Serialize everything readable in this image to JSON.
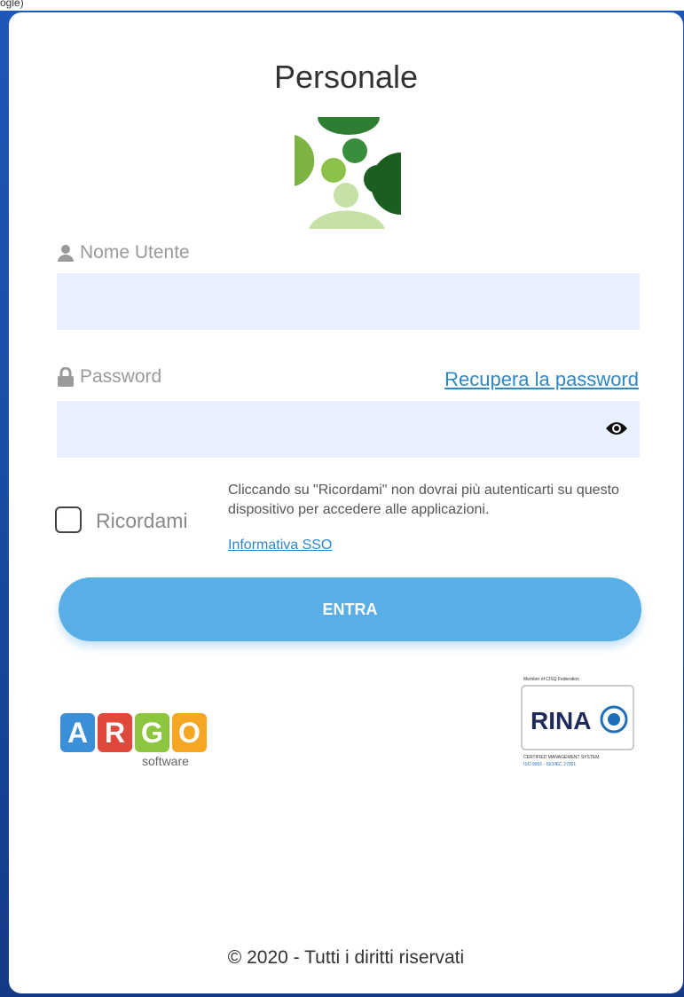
{
  "page": {
    "top_text": "ogle)",
    "title": "Personale",
    "copyright": "© 2020 - Tutti i diritti riservati"
  },
  "login": {
    "username_label": "Nome Utente",
    "username_value": "",
    "password_label": "Password",
    "password_value": "",
    "recover_link": "Recupera la password",
    "remember_label": "Ricordami",
    "remember_checked": false,
    "remember_note": "Cliccando su \"Ricordami\" non dovrai più autenticarti su questo dispositivo per accedere alle applicazioni.",
    "sso_link": "Informativa SSO",
    "submit_label": "ENTRA"
  },
  "icons": {
    "user": "user-icon",
    "lock": "lock-icon",
    "eye": "eye-icon"
  },
  "branding": {
    "argo_letters": [
      "A",
      "R",
      "G",
      "O"
    ],
    "argo_colors": [
      "#3a8fd8",
      "#e0483c",
      "#8cc63f",
      "#f5a623"
    ],
    "argo_sub": "software",
    "rina_text": "RINA",
    "rina_top": "Member of CISQ Federation",
    "rina_bottom1": "CERTIFIED MANAGEMENT SYSTEM",
    "rina_bottom2": "ISO 9001 - ISO/IEC 27001"
  },
  "colors": {
    "field_bg": "#e8f0fe",
    "button_bg": "#5aaee6",
    "link": "#2f86c7",
    "page_bg": "#1d57b8"
  }
}
